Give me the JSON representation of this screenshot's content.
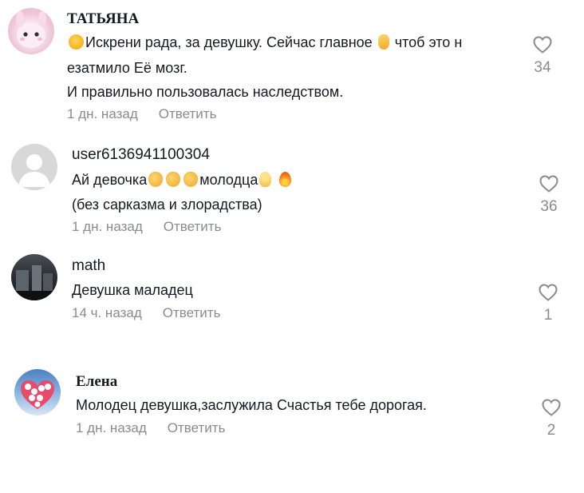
{
  "comments": [
    {
      "author": "ТАТЬЯНА",
      "text_line1_part1": "Искрени рада, за девушку. Сейчас главное",
      "text_line1_part2": "чтоб это н",
      "text_line2": "езатмило Её мозг.",
      "text_line3": "И правильно пользовалась наследством.",
      "time": "1 дн. назад",
      "reply": "Ответить",
      "likes": "34",
      "emojis": [
        "hugging-face-emoji",
        "pointing-finger-emoji"
      ]
    },
    {
      "author": "user6136941100304",
      "text_line1_part1": "Ай девочка",
      "text_line1_part2": "молодца",
      "text_line2": "(без сарказма и злорадства)",
      "time": "1 дн. назад",
      "reply": "Ответить",
      "likes": "36",
      "emojis": [
        "clapping-hands-emoji",
        "clapping-hands-emoji",
        "clapping-hands-emoji",
        "ok-hand-emoji",
        "fire-emoji"
      ]
    },
    {
      "author": "math",
      "text_line1": "Девушка маладец",
      "time": "14 ч. назад",
      "reply": "Ответить",
      "likes": "1"
    },
    {
      "author": "Елена",
      "text_line1": "Молодец девушка,заслужила Счастья тебе дорогая.",
      "time": "1 дн. назад",
      "reply": "Ответить",
      "likes": "2"
    }
  ],
  "colors": {
    "text": "#161823",
    "secondary": "#8a8b91",
    "background": "#ffffff"
  }
}
